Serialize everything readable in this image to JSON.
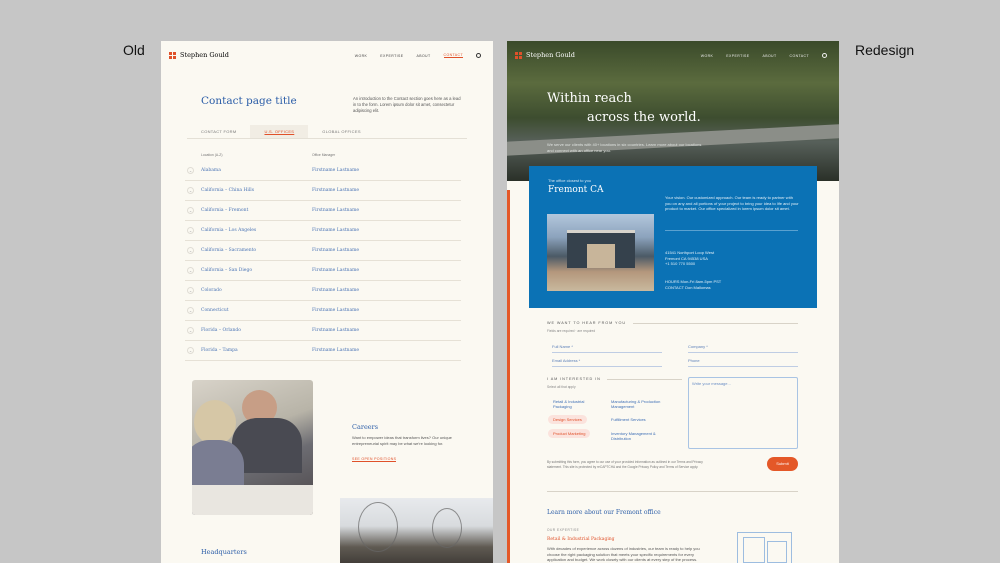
{
  "labels": {
    "old": "Old",
    "redesign": "Redesign"
  },
  "brand": "Stephen Gould",
  "nav": [
    "WORK",
    "EXPERTISE",
    "ABOUT",
    "CONTACT"
  ],
  "old": {
    "title": "Contact page title",
    "intro": "An introduction to the Contact section goes here as a lead in to the form. Lorem ipsum dolor sit amet, consectetur adipiscing elit.",
    "tabs": [
      "CONTACT FORM",
      "U.S. OFFICES",
      "GLOBAL OFFICES"
    ],
    "table_headers": [
      "Location (A-Z)",
      "Office Manager"
    ],
    "locations": [
      {
        "name": "Alabama",
        "manager": "Firstname Lastname"
      },
      {
        "name": "California – China Hills",
        "manager": "Firstname Lastname"
      },
      {
        "name": "California – Fremont",
        "manager": "Firstname Lastname"
      },
      {
        "name": "California – Los Angeles",
        "manager": "Firstname Lastname"
      },
      {
        "name": "California – Sacramento",
        "manager": "Firstname Lastname"
      },
      {
        "name": "California – San Diego",
        "manager": "Firstname Lastname"
      },
      {
        "name": "Colorado",
        "manager": "Firstname Lastname"
      },
      {
        "name": "Connecticut",
        "manager": "Firstname Lastname"
      },
      {
        "name": "Florida – Orlando",
        "manager": "Firstname Lastname"
      },
      {
        "name": "Florida – Tampa",
        "manager": "Firstname Lastname"
      }
    ],
    "careers_title": "Careers",
    "careers_text": "Want to empower ideas that transform lives? Our unique entrepreneurial spirit may be what we're looking for.",
    "careers_link": "SEE OPEN POSITIONS",
    "hq_title": "Headquarters"
  },
  "new": {
    "hero_line1": "Within reach",
    "hero_line2": "across the world.",
    "hero_text": "We serve our clients with 40+ locations in six countries. Learn more about our locations and connect with an office near you.",
    "office_pre": "The office closest to you",
    "office_city": "Fremont CA",
    "office_vision": "Your vision. Our customized approach. Our team is ready to partner with you on any and all portions of your project to bring your idea to life and your product to market. Our office specialized in lorem ipsum dolor sit amet.",
    "office_address": [
      "41541 Northport Loop West",
      "Fremont CA 94538 USA",
      "+1 510 770 5500"
    ],
    "office_hours": [
      "HOURS Mon-Fri 8am-5pm PST",
      "CONTACT Don Mallomas"
    ],
    "hear_label": "WE WANT TO HEAR FROM YOU",
    "required_note": "Fields are required · are required",
    "fields": {
      "full_name": "Full Name *",
      "company": "Company *",
      "email": "Email Address *",
      "phone": "Phone"
    },
    "interested_label": "I AM INTERESTED IN",
    "interested_sub": "Select all that apply",
    "options": [
      "Retail & Industrial Packaging",
      "Manufacturing & Production Management",
      "Design Services",
      "Fulfillment Services",
      "Product Marketing",
      "Inventory Management & Distribution"
    ],
    "message_placeholder": "Write your message...",
    "terms": "By submitting this form, you agree to our use of your provided information as outlined in our Terms and Privacy statement. This site is protected by reCAPTCHA and the Google Privacy Policy and Terms of Service apply.",
    "submit": "Submit",
    "learn_title": "Learn more about our Fremont office",
    "expertise_label": "OUR EXPERTISE",
    "expertise_heading": "Retail & Industrial Packaging",
    "expertise_text": "With decades of experience across dozens of industries, our team is ready to help you choose the right packaging solution that meets your specific requirements for every application and budget. We work closely with our clients at every step of the process."
  },
  "colors": {
    "accent": "#e0512a",
    "link": "#2c5ea8",
    "blue_panel": "#0b72b5"
  }
}
